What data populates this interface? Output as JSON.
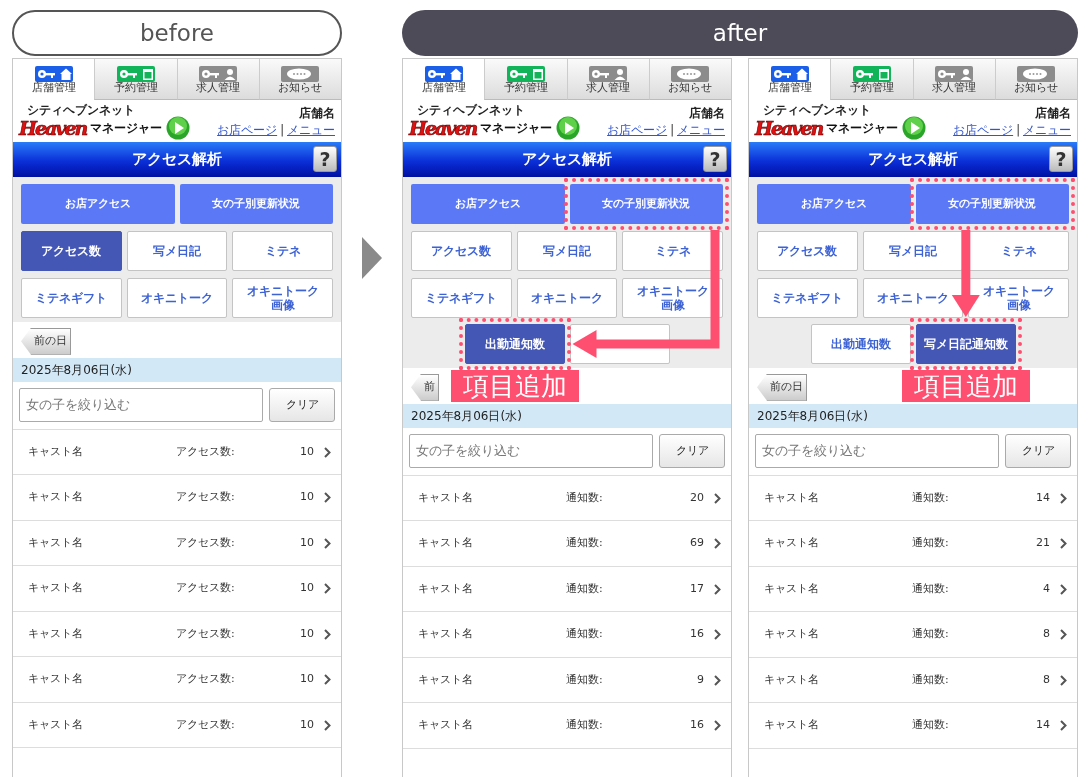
{
  "labels": [
    {
      "label": "before",
      "kind": "outline"
    },
    {
      "label": "after",
      "kind": "filled"
    }
  ],
  "screens": [
    {
      "tabs": [
        {
          "label": "店舗管理",
          "selected": true
        },
        {
          "label": "予約管理",
          "selected": false
        },
        {
          "label": "求人管理",
          "selected": false
        },
        {
          "label": "お知らせ",
          "selected": false
        }
      ],
      "logo": {
        "kana": "シティヘブンネット",
        "brand": "Heaven",
        "name": "マネージャー"
      },
      "shop_name": "店舗名",
      "links": [
        "お店ページ",
        "|",
        "メニュー"
      ],
      "title": "アクセス解析",
      "help": "?",
      "main_buttons": [
        {
          "label": "お店アクセス",
          "highlighted": false
        },
        {
          "label": "女の子別更新状況",
          "highlighted": false
        }
      ],
      "sub_buttons": [
        {
          "label": "アクセス数",
          "selected": true
        },
        {
          "label": "写メ日記",
          "selected": false
        },
        {
          "label": "ミテネ",
          "selected": false
        },
        {
          "label": "ミテネギフト",
          "selected": false
        },
        {
          "label": "オキニトーク",
          "selected": false
        },
        {
          "lines": [
            "オキニトーク",
            "画像"
          ],
          "selected": false
        }
      ],
      "prev_day": "前の日",
      "date": "2025年8月06日(水)",
      "search": {
        "placeholder": "女の子を絞り込む"
      },
      "clear": "クリア",
      "rows": [
        {
          "name": "キャスト名",
          "metric": "アクセス数:",
          "value": "10"
        },
        {
          "name": "キャスト名",
          "metric": "アクセス数:",
          "value": "10"
        },
        {
          "name": "キャスト名",
          "metric": "アクセス数:",
          "value": "10"
        },
        {
          "name": "キャスト名",
          "metric": "アクセス数:",
          "value": "10"
        },
        {
          "name": "キャスト名",
          "metric": "アクセス数:",
          "value": "10"
        },
        {
          "name": "キャスト名",
          "metric": "アクセス数:",
          "value": "10"
        },
        {
          "name": "キャスト名",
          "metric": "アクセス数:",
          "value": "10"
        }
      ]
    },
    {
      "tabs": [
        {
          "label": "店舗管理",
          "selected": true
        },
        {
          "label": "予約管理",
          "selected": false
        },
        {
          "label": "求人管理",
          "selected": false
        },
        {
          "label": "お知らせ",
          "selected": false
        }
      ],
      "logo": {
        "kana": "シティヘブンネット",
        "brand": "Heaven",
        "name": "マネージャー"
      },
      "shop_name": "店舗名",
      "links": [
        "お店ページ",
        "|",
        "メニュー"
      ],
      "title": "アクセス解析",
      "help": "?",
      "main_buttons": [
        {
          "label": "お店アクセス",
          "highlighted": false
        },
        {
          "label": "女の子別更新状況",
          "highlighted": true
        }
      ],
      "sub_buttons": [
        {
          "label": "アクセス数",
          "selected": false
        },
        {
          "label": "写メ日記",
          "selected": false
        },
        {
          "label": "ミテネ",
          "selected": false
        },
        {
          "label": "ミテネギフト",
          "selected": false
        },
        {
          "label": "オキニトーク",
          "selected": false
        },
        {
          "lines": [
            "オキニトーク",
            "画像"
          ],
          "selected": false
        }
      ],
      "extra_buttons": [
        {
          "label": "出勤通知数",
          "selected": true,
          "highlighted": true
        },
        {
          "selected": false,
          "highlighted": false
        }
      ],
      "annotation": {
        "arrow": {
          "kind": "elbow"
        },
        "callout": "項目追加"
      },
      "prev_day": "前",
      "date": "2025年8月06日(水)",
      "search": {
        "placeholder": "女の子を絞り込む"
      },
      "clear": "クリア",
      "rows": [
        {
          "name": "キャスト名",
          "metric": "通知数:",
          "value": "20"
        },
        {
          "name": "キャスト名",
          "metric": "通知数:",
          "value": "69"
        },
        {
          "name": "キャスト名",
          "metric": "通知数:",
          "value": "17"
        },
        {
          "name": "キャスト名",
          "metric": "通知数:",
          "value": "16"
        },
        {
          "name": "キャスト名",
          "metric": "通知数:",
          "value": "9"
        },
        {
          "name": "キャスト名",
          "metric": "通知数:",
          "value": "16"
        }
      ]
    },
    {
      "tabs": [
        {
          "label": "店舗管理",
          "selected": true
        },
        {
          "label": "予約管理",
          "selected": false
        },
        {
          "label": "求人管理",
          "selected": false
        },
        {
          "label": "お知らせ",
          "selected": false
        }
      ],
      "logo": {
        "kana": "シティヘブンネット",
        "brand": "Heaven",
        "name": "マネージャー"
      },
      "shop_name": "店舗名",
      "links": [
        "お店ページ",
        "|",
        "メニュー"
      ],
      "title": "アクセス解析",
      "help": "?",
      "main_buttons": [
        {
          "label": "お店アクセス",
          "highlighted": false
        },
        {
          "label": "女の子別更新状況",
          "highlighted": true
        }
      ],
      "sub_buttons": [
        {
          "label": "アクセス数",
          "selected": false
        },
        {
          "label": "写メ日記",
          "selected": false
        },
        {
          "label": "ミテネ",
          "selected": false
        },
        {
          "label": "ミテネギフト",
          "selected": false
        },
        {
          "label": "オキニトーク",
          "selected": false
        },
        {
          "lines": [
            "オキニトーク",
            "画像"
          ],
          "selected": false
        }
      ],
      "extra_buttons": [
        {
          "label": "出勤通知数",
          "selected": false,
          "highlighted": false
        },
        {
          "label": "写メ日記通知数",
          "selected": true,
          "highlighted": true
        }
      ],
      "annotation": {
        "arrow": {
          "kind": "down"
        },
        "callout": "項目追加"
      },
      "prev_day": "前の日",
      "date": "2025年8月06日(水)",
      "search": {
        "placeholder": "女の子を絞り込む"
      },
      "clear": "クリア",
      "rows": [
        {
          "name": "キャスト名",
          "metric": "通知数:",
          "value": "14"
        },
        {
          "name": "キャスト名",
          "metric": "通知数:",
          "value": "21"
        },
        {
          "name": "キャスト名",
          "metric": "通知数:",
          "value": "4"
        },
        {
          "name": "キャスト名",
          "metric": "通知数:",
          "value": "8"
        },
        {
          "name": "キャスト名",
          "metric": "通知数:",
          "value": "8"
        },
        {
          "name": "キャスト名",
          "metric": "通知数:",
          "value": "14"
        }
      ]
    }
  ]
}
